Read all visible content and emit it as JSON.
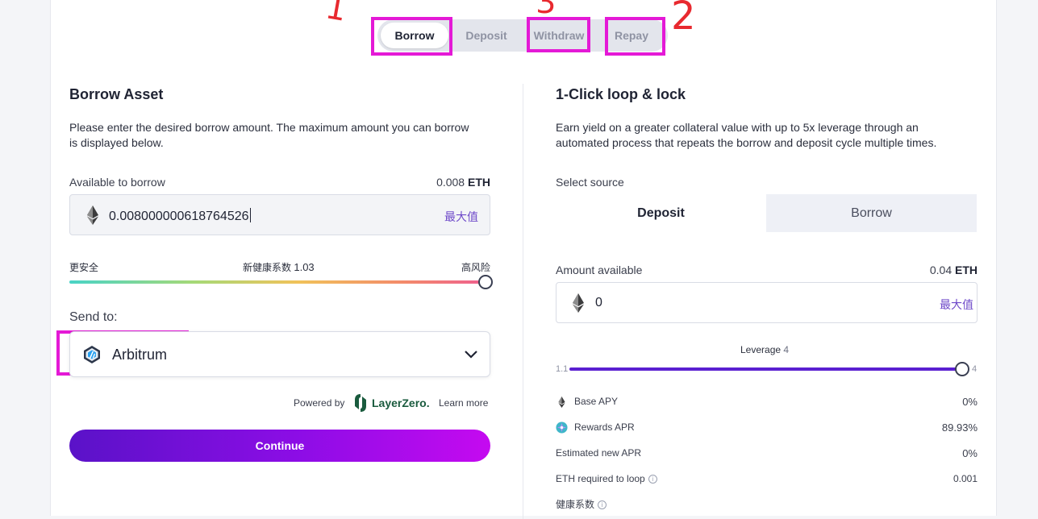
{
  "tabs": [
    {
      "label": "Borrow",
      "active": true
    },
    {
      "label": "Deposit",
      "active": false
    },
    {
      "label": "Withdraw",
      "active": false
    },
    {
      "label": "Repay",
      "active": false
    }
  ],
  "annotations": {
    "one": "1",
    "two": "2",
    "three": "3",
    "color": "#e8292f",
    "box_color": "#e419d6"
  },
  "borrow": {
    "title": "Borrow Asset",
    "description_line1": "Please enter the desired borrow amount. The maximum amount you can borrow",
    "description_line2": "is displayed below.",
    "available_label": "Available to borrow",
    "available_value": "0.008",
    "available_unit": "ETH",
    "input_value": "0.008000000618764526",
    "token_icon": "eth-icon",
    "max_label": "最大值",
    "safer_label": "更安全",
    "health_label": "新健康系数",
    "health_value": "1.03",
    "risk_label": "高风险",
    "health_slider_level": 1.0,
    "send_to_label": "Send to:",
    "network": "Arbitrum",
    "network_icon": "arbitrum-icon",
    "powered_by": "Powered by",
    "provider": "LayerZero.",
    "learn_more": "Learn more",
    "continue_label": "Continue"
  },
  "loop": {
    "title": "1-Click loop & lock",
    "description_line1": "Earn yield on a greater collateral value with up to 5x leverage through an",
    "description_line2": "automated process that repeats the borrow and deposit cycle multiple times.",
    "select_source_label": "Select source",
    "source_options": [
      "Deposit",
      "Borrow"
    ],
    "source_selected": "Deposit",
    "amount_label": "Amount available",
    "amount_value": "0.04",
    "amount_unit": "ETH",
    "input_value": "0",
    "max_label": "最大值",
    "leverage_label": "Leverage",
    "leverage_value": "4",
    "leverage_min": "1.1",
    "leverage_max": "4",
    "rows": [
      {
        "label": "Base APY",
        "value": "0%",
        "icon": "eth-icon"
      },
      {
        "label": "Rewards APR",
        "value": "89.93%",
        "icon": "rewards-icon"
      },
      {
        "label": "Estimated new APR",
        "value": "0%"
      },
      {
        "label": "ETH required to loop",
        "value": "0.001"
      }
    ],
    "cut_row_label": "健康系数"
  },
  "colors": {
    "accent": "#6e49c9",
    "button_start": "#5a12c8",
    "button_end": "#c50af0",
    "leverage": "#5a1fd1"
  }
}
